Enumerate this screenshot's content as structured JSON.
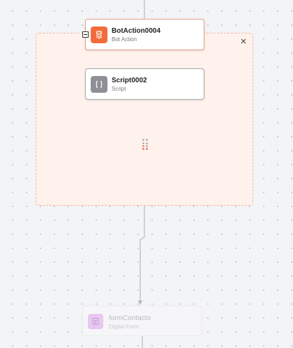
{
  "group": {
    "close_icon": "close-icon",
    "close_glyph": "×"
  },
  "nodes": {
    "bot_action": {
      "title": "BotAction0004",
      "subtitle": "Bot Action",
      "icon": "bot-action-icon",
      "color": "#f26b3a"
    },
    "script": {
      "title": "Script0002",
      "subtitle": "Script",
      "icon": "script-braces-icon",
      "color": "#8e9096"
    },
    "form": {
      "title": "formContacto",
      "subtitle": "Digital Form",
      "icon": "form-document-icon",
      "color": "#e6c8f1"
    }
  },
  "colors": {
    "canvas": "#f3f4f6",
    "group_fill": "#fff1ec",
    "group_border": "#f0b7a5",
    "edge": "#444444",
    "edge_faded": "#b9b9bd"
  }
}
